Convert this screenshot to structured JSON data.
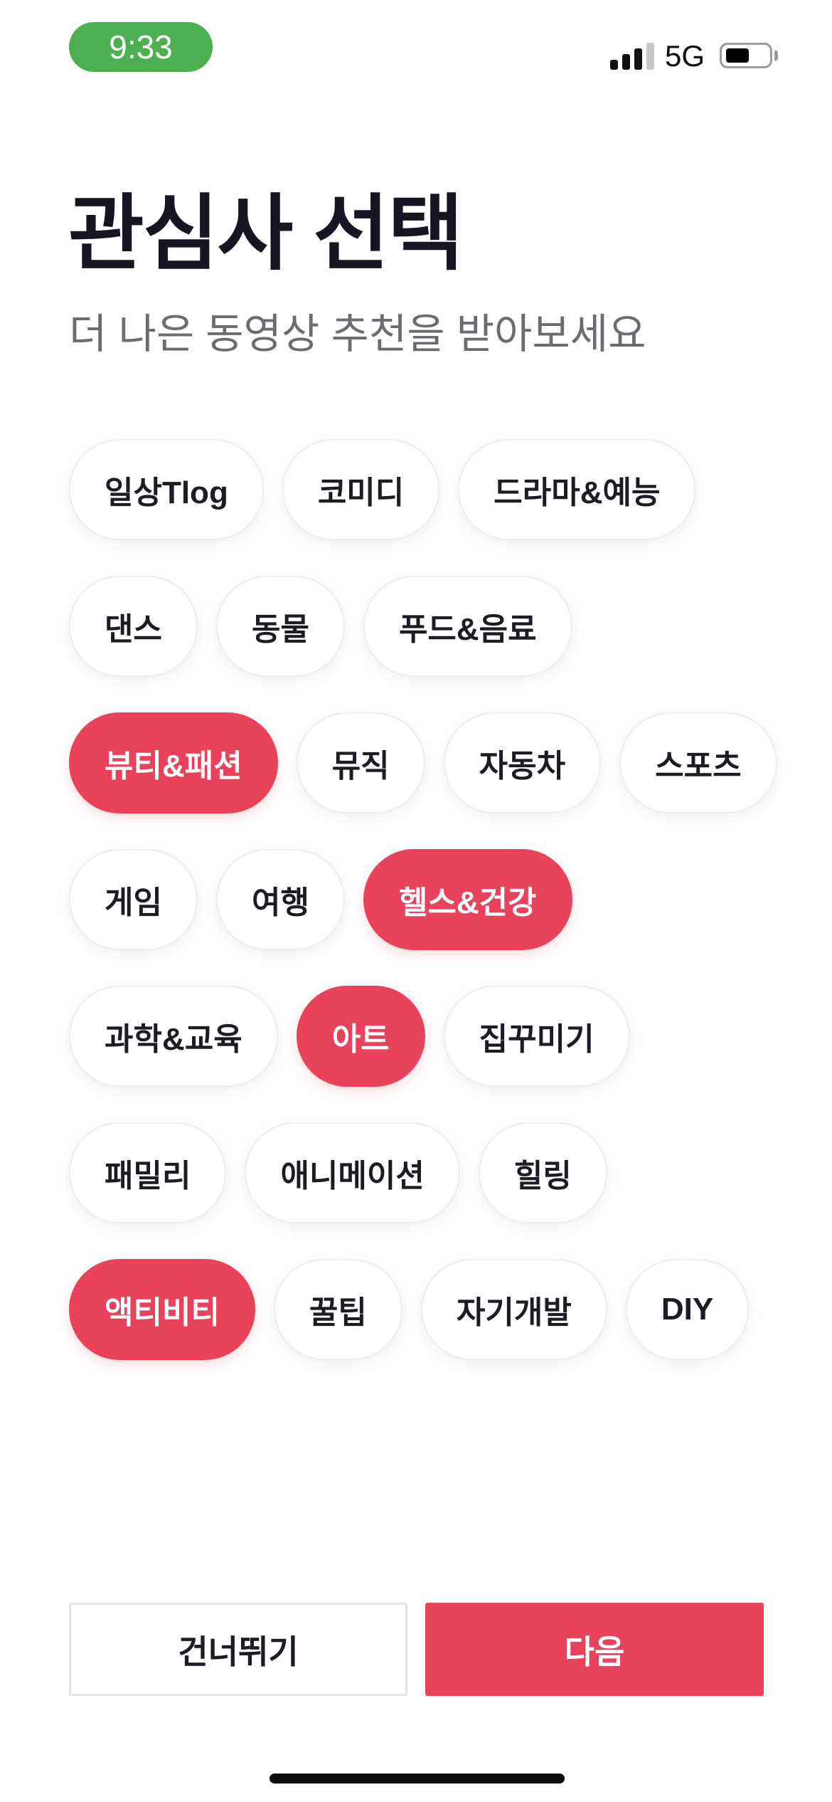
{
  "status_bar": {
    "time": "9:33",
    "network": "5G",
    "signal_bars": 3,
    "battery_level": 0.5
  },
  "header": {
    "title": "관심사 선택",
    "subtitle": "더 나은 동영상 추천을 받아보세요"
  },
  "interests": {
    "rows": [
      [
        {
          "label": "일상Tlog",
          "selected": false
        },
        {
          "label": "코미디",
          "selected": false
        },
        {
          "label": "드라마&예능",
          "selected": false
        }
      ],
      [
        {
          "label": "댄스",
          "selected": false
        },
        {
          "label": "동물",
          "selected": false
        },
        {
          "label": "푸드&음료",
          "selected": false
        }
      ],
      [
        {
          "label": "뷰티&패션",
          "selected": true
        },
        {
          "label": "뮤직",
          "selected": false
        },
        {
          "label": "자동차",
          "selected": false
        },
        {
          "label": "스포츠",
          "selected": false
        }
      ],
      [
        {
          "label": "게임",
          "selected": false
        },
        {
          "label": "여행",
          "selected": false
        },
        {
          "label": "헬스&건강",
          "selected": true
        }
      ],
      [
        {
          "label": "과학&교육",
          "selected": false
        },
        {
          "label": "아트",
          "selected": true
        },
        {
          "label": "집꾸미기",
          "selected": false
        }
      ],
      [
        {
          "label": "패밀리",
          "selected": false
        },
        {
          "label": "애니메이션",
          "selected": false
        },
        {
          "label": "힐링",
          "selected": false
        }
      ],
      [
        {
          "label": "액티비티",
          "selected": true
        },
        {
          "label": "꿀팁",
          "selected": false
        },
        {
          "label": "자기개발",
          "selected": false
        },
        {
          "label": "DIY",
          "selected": false
        }
      ]
    ]
  },
  "actions": {
    "skip_label": "건너뛰기",
    "next_label": "다음"
  },
  "colors": {
    "accent": "#e8435a",
    "time_pill": "#4caf50",
    "title": "#161622",
    "subtitle": "#6b6b72"
  }
}
